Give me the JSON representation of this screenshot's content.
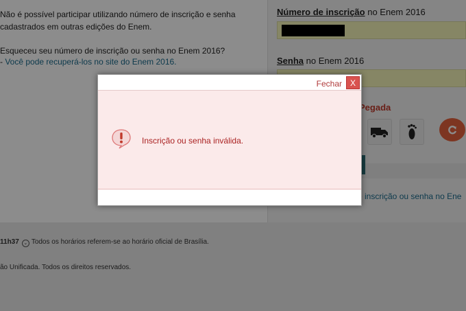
{
  "page": {
    "notice_line1": "Não é possível participar utilizando número de inscrição e senha",
    "notice_line2": "cadastrados em outras edições do Enem.",
    "forgot_question": "Esqueceu seu número de inscrição ou senha no Enem 2016?",
    "forgot_prefix": "- ",
    "forgot_link": "Você pode recuperá-los no site do Enem 2016.",
    "login": {
      "inscricao_label": "Número de inscrição",
      "inscricao_suffix": " no Enem 2016",
      "senha_label": "Senha",
      "senha_suffix": " no Enem 2016"
    },
    "captcha_title": "Pegada",
    "captcha_icons": [
      "truck-icon",
      "footprint-icon"
    ],
    "recover_link": "e inscrição ou senha no Ene",
    "footer": {
      "time": "11h37",
      "time_note": "Todos os horários referem-se ao horário oficial de Brasília.",
      "copyright": "ão Unificada. Todos os direitos reservados."
    }
  },
  "modal": {
    "close_label": "Fechar",
    "close_x": "X",
    "message": "Inscrição ou senha inválida.",
    "icon": "warning-speech-icon"
  },
  "colors": {
    "modal_body": "#fbeaea",
    "message": "#aa2222",
    "close_button": "#d9534f",
    "refresh_button": "#e4613d",
    "link": "#1a6b8c"
  }
}
